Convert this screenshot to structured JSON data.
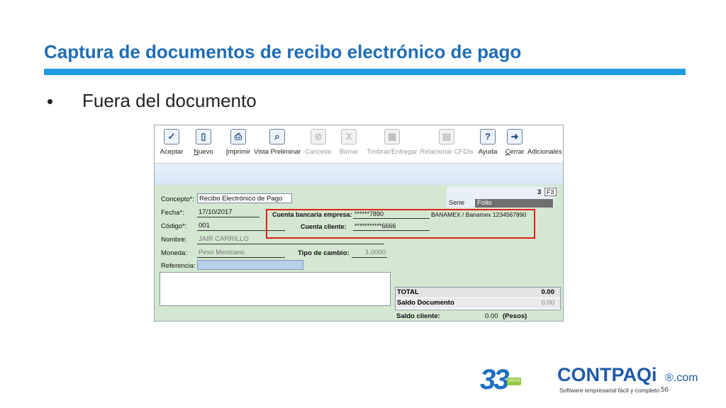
{
  "slide": {
    "title": "Captura de documentos de recibo electrónico de pago",
    "bullet": "•",
    "bullet_text": "Fuera del documento",
    "page_number": "56"
  },
  "toolbar": [
    {
      "label": "Aceptar",
      "icon": "check-icon",
      "disabled": false
    },
    {
      "label": "Nuevo",
      "icon": "new-document-icon",
      "disabled": false
    },
    {
      "label": "Imprimir",
      "icon": "printer-icon",
      "disabled": false
    },
    {
      "label": "Vista Preliminar",
      "icon": "print-preview-icon",
      "disabled": false
    },
    {
      "label": "Cancelar",
      "icon": "cancel-icon",
      "disabled": true
    },
    {
      "label": "Borrar",
      "icon": "delete-icon",
      "disabled": true
    },
    {
      "label": "Timbrar/Entregar",
      "icon": "stamp-icon",
      "disabled": true
    },
    {
      "label": "Relacionar CFDIs",
      "icon": "relate-icon",
      "disabled": true
    },
    {
      "label": "Ayuda",
      "icon": "help-icon",
      "disabled": false
    },
    {
      "label": "Cerrar",
      "icon": "exit-icon",
      "disabled": false
    },
    {
      "label": "Adicionales",
      "icon": "",
      "disabled": false
    }
  ],
  "form": {
    "concepto_label": "Concepto*:",
    "concepto_value": "Recibo Electrónico de Pago",
    "fecha_label": "Fecha*:",
    "fecha_value": "17/10/2017",
    "codigo_label": "Código*:",
    "codigo_value": "001",
    "nombre_label": "Nombre:",
    "nombre_value": "JAIR CARRILLO",
    "moneda_label": "Moneda:",
    "moneda_value": "Peso Mexicano",
    "tipo_cambio_label": "Tipo de cambio:",
    "tipo_cambio_value": "1.0000",
    "referencia_label": "Referencia:",
    "referencia_value": "",
    "cuenta_empresa_label": "Cuenta bancaria empresa:",
    "cuenta_empresa_value": "******7890",
    "cuenta_empresa_banco": "BANAMEX / Banamex 1234567890",
    "cuenta_cliente_label": "Cuenta cliente:",
    "cuenta_cliente_value": "***********6666",
    "serie_label": "Serie",
    "folio_label": "Folio",
    "folio_value": "3",
    "f3_label": "F3"
  },
  "totals": {
    "total_label": "TOTAL",
    "total_value": "0.00",
    "saldo_doc_label": "Saldo Documento",
    "saldo_doc_value": "0.00",
    "saldo_cliente_label": "Saldo cliente:",
    "saldo_cliente_value": "0.00",
    "saldo_cliente_currency": "(Pesos)"
  },
  "logos": {
    "anniversary": "33",
    "anniversary_badge": "AÑOS",
    "brand": "CONTPAQi",
    "brand_suffix": "®.com",
    "tagline": "Software empresarial fácil y completo"
  },
  "colors": {
    "title": "#1f6db5",
    "rule": "#1e9be0",
    "form_bg": "#d4e7d1",
    "highlight": "#e0201b"
  }
}
